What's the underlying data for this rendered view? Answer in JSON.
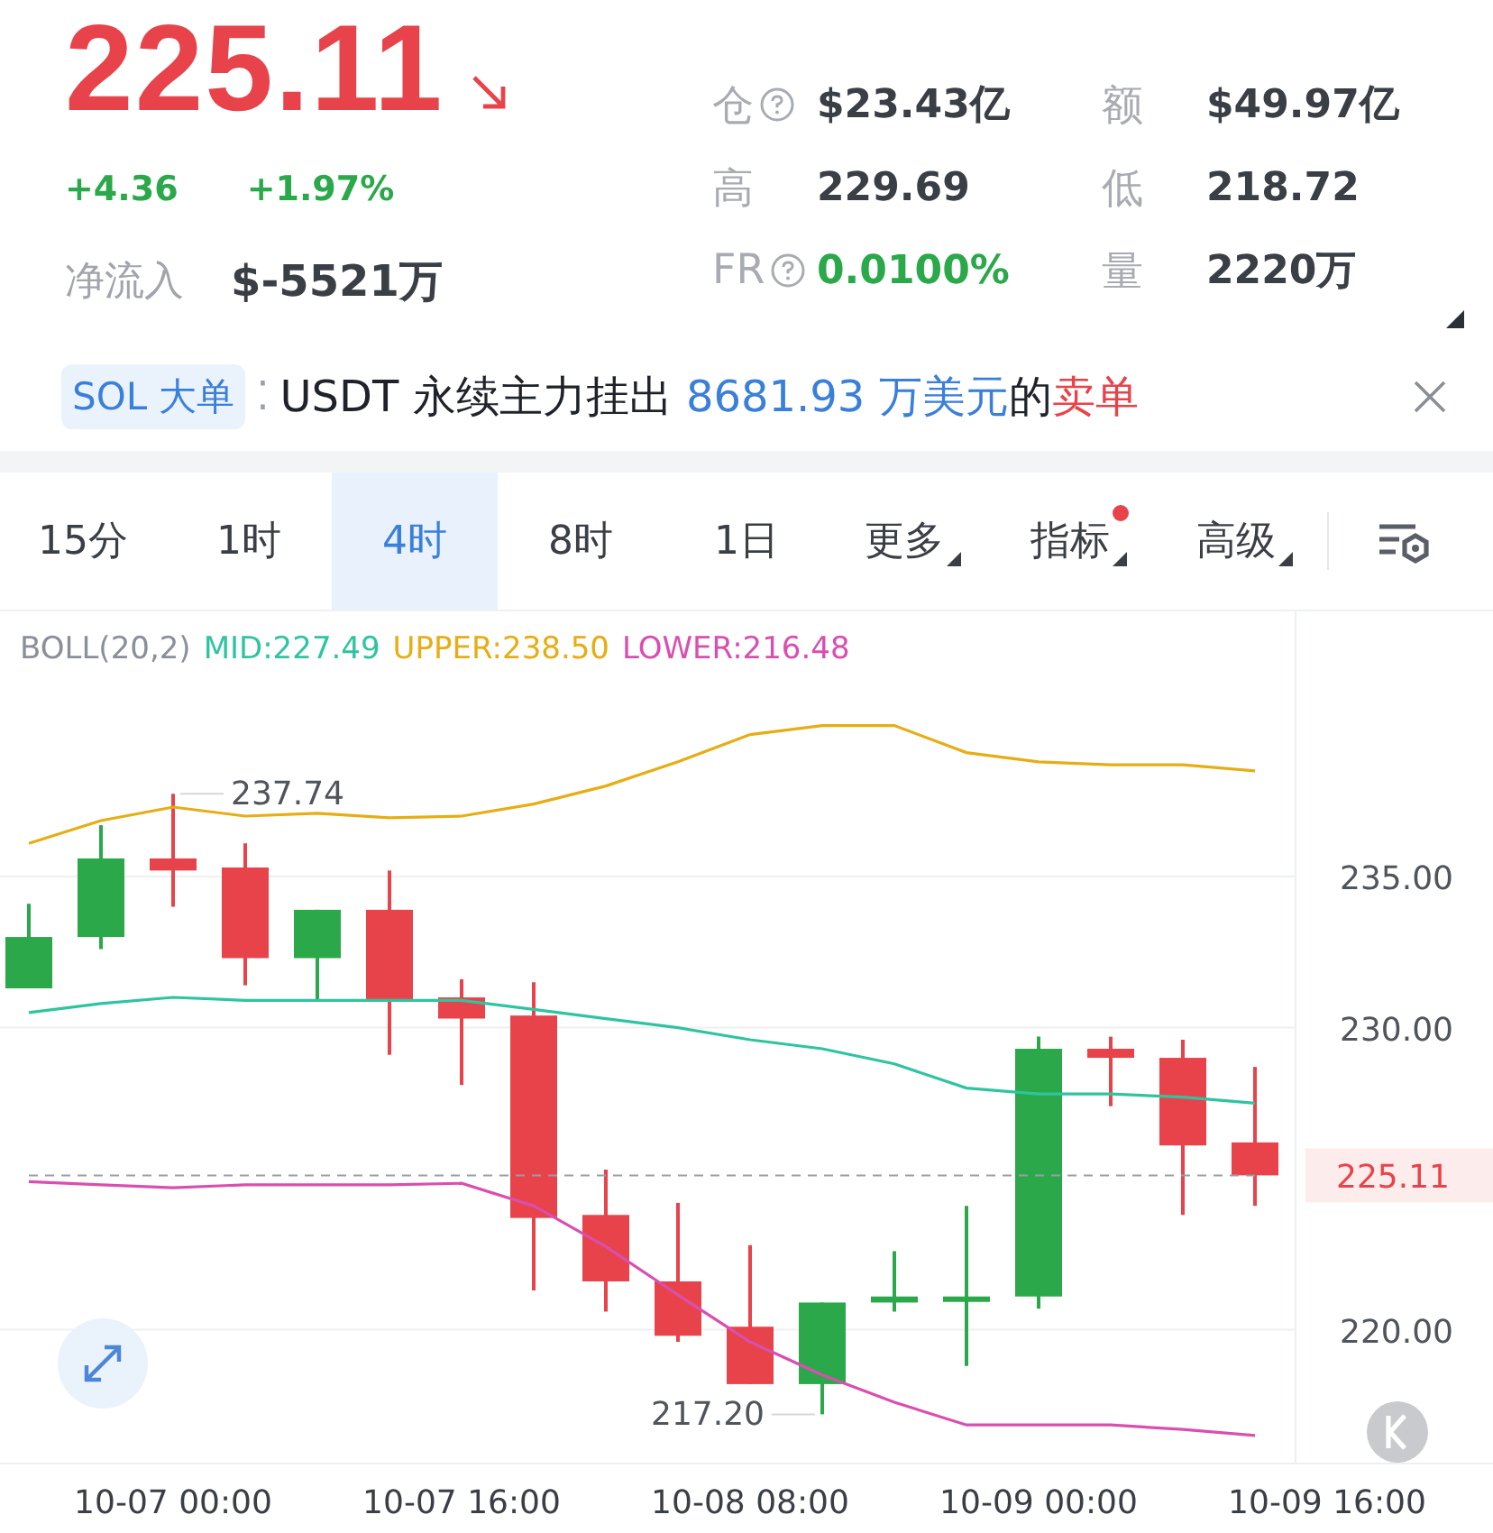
{
  "quote": {
    "price": "225.11",
    "falling": true,
    "change": "+4.36",
    "change_pct": "+1.97%",
    "net_inflow_label": "净流入",
    "net_inflow": "$-5521万"
  },
  "stats": [
    {
      "label": "仓",
      "help": true,
      "value": "$23.43亿",
      "color": "#3a3e45"
    },
    {
      "label": "额",
      "help": false,
      "value": "$49.97亿",
      "color": "#3a3e45"
    },
    {
      "label": "高",
      "help": false,
      "value": "229.69",
      "color": "#3a3e45"
    },
    {
      "label": "低",
      "help": false,
      "value": "218.72",
      "color": "#3a3e45"
    },
    {
      "label": "FR",
      "help": true,
      "value": "0.0100%",
      "color": "#2aa84a"
    },
    {
      "label": "量",
      "help": false,
      "value": "2220万",
      "color": "#3a3e45"
    }
  ],
  "ticker": {
    "tag": "SOL 大单",
    "separator": "⁚",
    "segments": [
      {
        "kind": "plain",
        "text": "USDT 永续主力挂出 "
      },
      {
        "kind": "amount",
        "text": "8681.93 万美元"
      },
      {
        "kind": "plain",
        "text": "的"
      },
      {
        "kind": "sell",
        "text": "卖单"
      }
    ]
  },
  "intervals": [
    {
      "label": "15分",
      "selected": false,
      "menu": false,
      "dot": false
    },
    {
      "label": "1时",
      "selected": false,
      "menu": false,
      "dot": false
    },
    {
      "label": "4时",
      "selected": true,
      "menu": false,
      "dot": false
    },
    {
      "label": "8时",
      "selected": false,
      "menu": false,
      "dot": false
    },
    {
      "label": "1日",
      "selected": false,
      "menu": false,
      "dot": false
    },
    {
      "label": "更多",
      "selected": false,
      "menu": true,
      "dot": false
    },
    {
      "label": "指标",
      "selected": false,
      "menu": true,
      "dot": true
    },
    {
      "label": "高级",
      "selected": false,
      "menu": true,
      "dot": false
    }
  ],
  "chart": {
    "legend": [
      {
        "text": "BOLL(20,2)",
        "color": "#8a8f99"
      },
      {
        "text": "MID:227.49",
        "color": "#2fc4a0"
      },
      {
        "text": "UPPER:238.50",
        "color": "#e6ad14"
      },
      {
        "text": "LOWER:216.48",
        "color": "#d94fb0"
      }
    ],
    "high_label": "237.74",
    "low_label": "217.20",
    "last_price_label": "225.11",
    "chart_data": {
      "type": "line",
      "grid": true,
      "categories": [
        null,
        null,
        "10-07 00:00",
        null,
        null,
        null,
        "10-07 16:00",
        null,
        null,
        null,
        "10-08 08:00",
        null,
        null,
        null,
        "10-09 00:00",
        null,
        null,
        null,
        "10-09 16:00"
      ],
      "ylim": [
        215.6,
        241.27
      ],
      "yticks": [
        {
          "value": 220,
          "label": "220.00"
        },
        {
          "value": 230,
          "label": "230.00"
        },
        {
          "value": 235,
          "label": "235.00"
        }
      ],
      "series": [
        {
          "color": "#e6ad14",
          "line_style": "solid",
          "values": [
            236.1,
            236.85,
            237.3,
            237.0,
            237.1,
            236.95,
            237.0,
            237.4,
            238.0,
            238.8,
            239.7,
            240.0,
            240.0,
            239.1,
            238.8,
            238.7,
            238.7,
            238.5,
            null
          ]
        },
        {
          "color": "#2fc4a0",
          "line_style": "solid",
          "values": [
            230.5,
            230.8,
            231.0,
            230.9,
            230.9,
            230.9,
            230.9,
            230.6,
            230.3,
            230.0,
            229.6,
            229.3,
            228.8,
            228.0,
            227.8,
            227.8,
            227.7,
            227.5,
            null
          ]
        },
        {
          "color": "#d94fb0",
          "line_style": "solid",
          "values": [
            224.9,
            224.8,
            224.7,
            224.8,
            224.8,
            224.8,
            224.85,
            224.1,
            222.75,
            221.15,
            219.6,
            218.5,
            217.6,
            216.85,
            216.85,
            216.85,
            216.7,
            216.5,
            null
          ]
        },
        {
          "color": "#9a9ea5",
          "line_style": "dashed",
          "values": [
            225.11,
            225.11,
            225.11,
            225.11,
            225.11,
            225.11,
            225.11,
            225.11,
            225.11,
            225.11,
            225.11,
            225.11,
            225.11,
            225.11,
            225.11,
            225.11,
            225.11,
            225.11,
            null
          ]
        }
      ]
    }
  }
}
